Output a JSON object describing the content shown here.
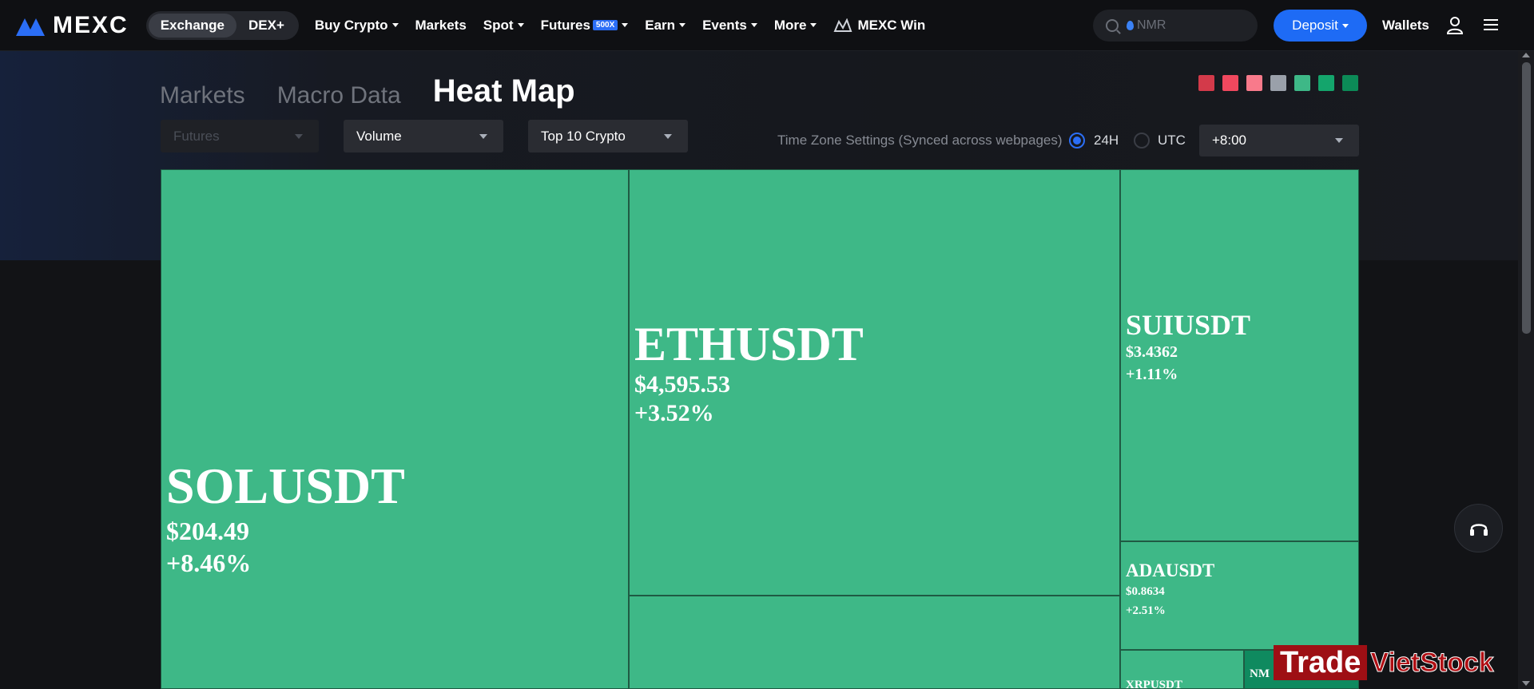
{
  "header": {
    "logo_text": "MEXC",
    "segments": [
      "Exchange",
      "DEX+"
    ],
    "nav": [
      {
        "label": "Buy Crypto",
        "caret": true
      },
      {
        "label": "Markets",
        "caret": false
      },
      {
        "label": "Spot",
        "caret": true
      },
      {
        "label": "Futures",
        "caret": true,
        "badge": "500X"
      },
      {
        "label": "Earn",
        "caret": true
      },
      {
        "label": "Events",
        "caret": true
      },
      {
        "label": "More",
        "caret": true
      }
    ],
    "win_label": "MEXC Win",
    "search_placeholder": "NMR",
    "deposit_label": "Deposit",
    "wallets_label": "Wallets"
  },
  "tabs": [
    "Markets",
    "Macro Data",
    "Heat Map"
  ],
  "active_tab": "Heat Map",
  "legend_colors": [
    "#d33a4a",
    "#f0485e",
    "#f87a8b",
    "#9aa0aa",
    "#3eb887",
    "#14a56c",
    "#0c8a57"
  ],
  "filters": {
    "market_type": "Futures",
    "metric": "Volume",
    "scope": "Top 10 Crypto"
  },
  "timezone": {
    "label": "Time Zone Settings (Synced across webpages)",
    "option_24h": "24H",
    "option_utc": "UTC",
    "selected": "24H",
    "offset": "+8:00"
  },
  "heatmap": {
    "cells": [
      {
        "symbol": "SOLUSDT",
        "price": "$204.49",
        "change": "+8.46%"
      },
      {
        "symbol": "ETHUSDT",
        "price": "$4,595.53",
        "change": "+3.52%"
      },
      {
        "symbol": "SUIUSDT",
        "price": "$3.4362",
        "change": "+1.11%"
      },
      {
        "symbol": "ADAUSDT",
        "price": "$0.8634",
        "change": "+2.51%"
      },
      {
        "symbol": "XRPUSDT",
        "price": "",
        "change": ""
      },
      {
        "symbol": "NM",
        "price": "",
        "change": ""
      }
    ]
  },
  "watermark": {
    "part1": "Trade",
    "part2": "VietStock"
  }
}
